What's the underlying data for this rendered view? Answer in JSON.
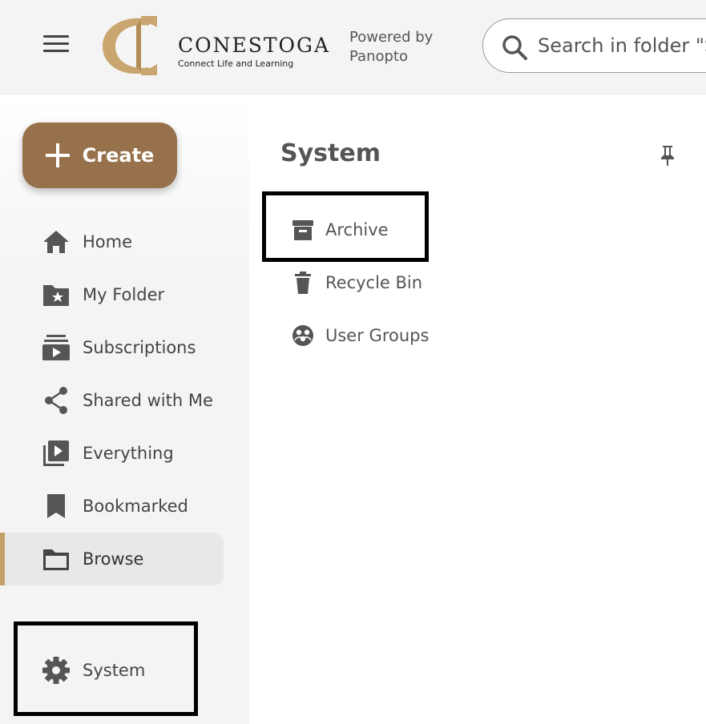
{
  "header": {
    "brand_name": "CONESTOGA",
    "brand_tagline": "Connect Life and Learning",
    "powered_by": "Powered by Panopto",
    "search_placeholder": "Search in folder \"System\""
  },
  "sidebar": {
    "create_label": "Create",
    "items": [
      {
        "label": "Home",
        "icon": "home-icon"
      },
      {
        "label": "My Folder",
        "icon": "folder-star-icon"
      },
      {
        "label": "Subscriptions",
        "icon": "subscriptions-icon"
      },
      {
        "label": "Shared with Me",
        "icon": "share-icon"
      },
      {
        "label": "Everything",
        "icon": "video-library-icon"
      },
      {
        "label": "Bookmarked",
        "icon": "bookmark-icon"
      },
      {
        "label": "Browse",
        "icon": "folder-icon",
        "active": true
      }
    ],
    "system_label": "System"
  },
  "main": {
    "title": "System",
    "items": [
      {
        "label": "Archive",
        "icon": "archive-icon"
      },
      {
        "label": "Recycle Bin",
        "icon": "trash-icon"
      },
      {
        "label": "User Groups",
        "icon": "user-groups-icon"
      }
    ]
  },
  "colors": {
    "accent": "#97714b",
    "active_bar": "#c4a06a",
    "header_bg": "#f4f4f4",
    "highlight_border": "#000000"
  }
}
